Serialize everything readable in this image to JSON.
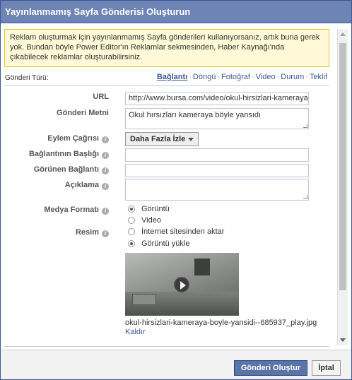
{
  "dialog": {
    "title": "Yayınlanmamış Sayfa Gönderisi Oluşturun"
  },
  "notice": {
    "text": "Reklam oluşturmak için yayınlanmamış Sayfa gönderileri kullanıyorsanız, artık buna gerek yok. Bundan böyle Power Editor'ın Reklamlar sekmesinden, Haber Kaynağı'nda çıkabilecek reklamlar oluşturabilirsiniz."
  },
  "post_type": {
    "label": "Gönderi Türü:",
    "options": [
      "Bağlantı",
      "Döngü",
      "Fotoğraf",
      "Video",
      "Durum",
      "Teklif"
    ],
    "selected": "Bağlantı",
    "separator": "·"
  },
  "form": {
    "url_label": "URL",
    "url_value": "http://www.bursa.com/video/okul-hirsizlari-kameraya-l",
    "message_label": "Gönderi Metni",
    "message_value": "Okul hırsızları kameraya böyle yansıdı",
    "cta_label": "Eylem Çağrısı",
    "cta_value": "Daha Fazla İzle",
    "link_title_label": "Bağlantının Başlığı",
    "link_title_value": "",
    "display_link_label": "Görünen Bağlantı",
    "display_link_value": "",
    "description_label": "Açıklama",
    "description_value": "",
    "media_label": "Medya Formatı",
    "media_options": [
      "Görüntü",
      "Video"
    ],
    "media_selected": "Görüntü",
    "image_label": "Resim",
    "image_options": [
      "İnternet sitesinden aktar",
      "Görüntü yükle"
    ],
    "image_selected": "Görüntü yükle",
    "image_filename": "okul-hirsizlari-kameraya-boyle-yansidi--685937_play.jpg",
    "remove_label": "Kaldır",
    "info_glyph": "i"
  },
  "footer": {
    "create_label": "Gönderi Oluştur",
    "cancel_label": "İptal"
  },
  "colors": {
    "title_bg": "#6d84b4",
    "link": "#3b5998",
    "notice_bg": "#fff9d7",
    "primary_button": "#5b74a8"
  }
}
